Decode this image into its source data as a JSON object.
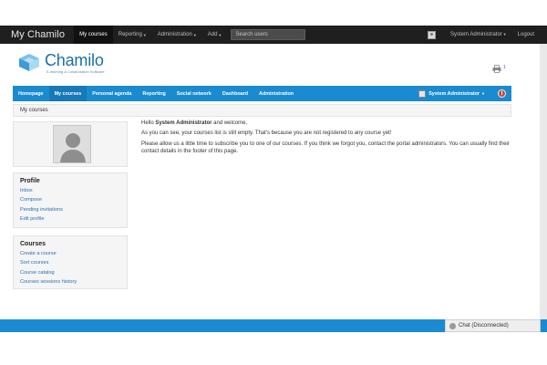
{
  "topbar": {
    "brand": "My Chamilo",
    "nav": [
      {
        "label": "My courses",
        "active": true,
        "dropdown": false
      },
      {
        "label": "Reporting",
        "active": false,
        "dropdown": true
      },
      {
        "label": "Administration",
        "active": false,
        "dropdown": true
      },
      {
        "label": "Add",
        "active": false,
        "dropdown": true
      }
    ],
    "search_placeholder": "Search users",
    "user_label": "System Administrator",
    "logout_label": "Logout"
  },
  "header": {
    "logo_text": "Chamilo",
    "logo_subtitle": "E-learning & Collaboration Software",
    "print_count": "1"
  },
  "mainnav": {
    "tabs": [
      {
        "label": "Homepage",
        "active": false
      },
      {
        "label": "My courses",
        "active": true
      },
      {
        "label": "Personal agenda",
        "active": false
      },
      {
        "label": "Reporting",
        "active": false
      },
      {
        "label": "Social network",
        "active": false
      },
      {
        "label": "Dashboard",
        "active": false
      },
      {
        "label": "Administration",
        "active": false
      }
    ],
    "user_label": "System Administrator"
  },
  "breadcrumb": "My courses",
  "profile": {
    "title": "Profile",
    "links": [
      "Inbox",
      "Compose",
      "Pending invitations",
      "Edit profile"
    ]
  },
  "courses": {
    "title": "Courses",
    "links": [
      "Create a course",
      "Sort courses",
      "Course catalog",
      "Courses sessions history"
    ]
  },
  "main": {
    "greeting_prefix": "Hello ",
    "greeting_name": "System Administrator",
    "greeting_suffix": " and welcome,",
    "line2": "As you can see, your courses list is still empty. That's because you are not registered to any course yet!",
    "line3": "Please allow us a little time to subscribe you to one of our courses. If you think we forgot you, contact the portal administrators. You can usually find their contact details in the footer of this page."
  },
  "chat": {
    "label": "Chat (Disconnected)"
  },
  "colors": {
    "topbar": "#1f1f1f",
    "accent_blue": "#1a8bd0",
    "link": "#2a6fb8"
  }
}
